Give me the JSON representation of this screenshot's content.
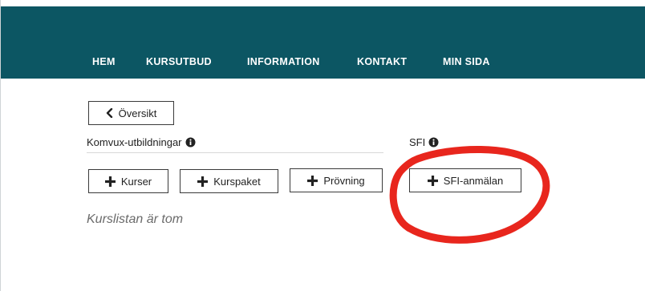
{
  "nav": {
    "items": [
      {
        "label": "HEM"
      },
      {
        "label": "KURSUTBUD"
      },
      {
        "label": "INFORMATION"
      },
      {
        "label": "KONTAKT"
      },
      {
        "label": "MIN SIDA"
      }
    ]
  },
  "back_button": {
    "label": "Översikt",
    "icon": "chevron-left-icon"
  },
  "komvux_section": {
    "label": "Komvux-utbildningar",
    "info_icon": "info-circle-icon",
    "buttons": [
      {
        "label": "Kurser",
        "icon": "plus-icon"
      },
      {
        "label": "Kurspaket",
        "icon": "plus-icon"
      },
      {
        "label": "Prövning",
        "icon": "plus-icon"
      }
    ]
  },
  "sfi_section": {
    "label": "SFI",
    "info_icon": "info-circle-icon",
    "button": {
      "label": "SFI-anmälan",
      "icon": "plus-icon"
    }
  },
  "course_list": {
    "empty_text": "Kurslistan är tom"
  },
  "colors": {
    "header_bg": "#0c5663",
    "annotation_circle": "#e8261d",
    "text": "#222222",
    "muted_text": "#6b6b6b"
  }
}
